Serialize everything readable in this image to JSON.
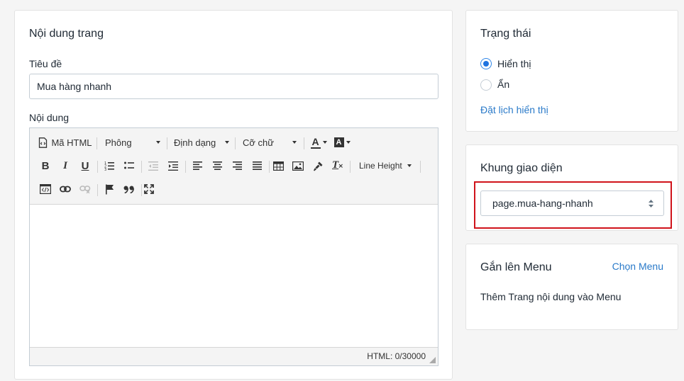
{
  "content_card": {
    "title": "Nội dung trang",
    "title_field_label": "Tiêu đề",
    "title_field_value": "Mua hàng nhanh",
    "content_label": "Nội dung",
    "toolbar": {
      "html_label": "Mã HTML",
      "font_label": "Phông",
      "format_label": "Định dạng",
      "size_label": "Cỡ chữ",
      "line_height_label": "Line Height",
      "bold": "B",
      "italic": "I",
      "underline": "U",
      "text_color_glyph": "A",
      "bg_color_glyph": "A",
      "clear_format_glyph": "T"
    },
    "char_count": "HTML: 0/30000"
  },
  "status_card": {
    "title": "Trạng thái",
    "options": [
      {
        "label": "Hiển thị",
        "checked": true
      },
      {
        "label": "Ẩn",
        "checked": false
      }
    ],
    "schedule_link": "Đặt lịch hiển thị"
  },
  "layout_card": {
    "title": "Khung giao diện",
    "selected_value": "page.mua-hang-nhanh",
    "highlight_color": "#d0131b"
  },
  "menu_card": {
    "title": "Gắn lên Menu",
    "action_link": "Chọn Menu",
    "description": "Thêm Trang nội dung vào Menu"
  },
  "colors": {
    "link": "#2a7ac9",
    "radio_checked": "#1e73e0"
  }
}
